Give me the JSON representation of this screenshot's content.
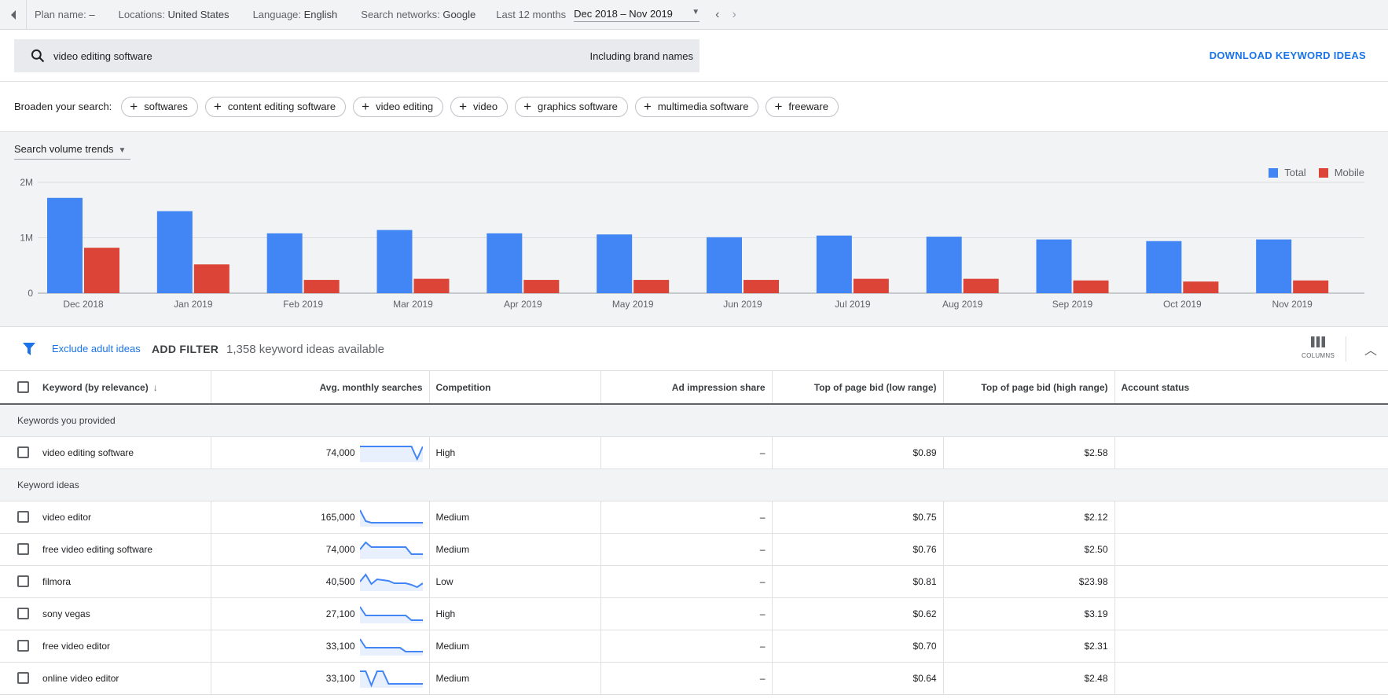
{
  "topbar": {
    "plan_label": "Plan name:",
    "plan_value": "–",
    "locations_label": "Locations:",
    "locations_value": "United States",
    "language_label": "Language:",
    "language_value": "English",
    "networks_label": "Search networks:",
    "networks_value": "Google",
    "period_label": "Last 12 months",
    "period_value": "Dec 2018 – Nov 2019"
  },
  "search": {
    "query": "video editing software",
    "brand_toggle": "Including brand names",
    "download_label": "DOWNLOAD KEYWORD IDEAS"
  },
  "broaden": {
    "label": "Broaden your search:",
    "chips": [
      "softwares",
      "content editing software",
      "video editing",
      "video",
      "graphics software",
      "multimedia software",
      "freeware"
    ]
  },
  "trend": {
    "selector_label": "Search volume trends"
  },
  "chart_data": {
    "type": "bar",
    "categories": [
      "Dec 2018",
      "Jan 2019",
      "Feb 2019",
      "Mar 2019",
      "Apr 2019",
      "May 2019",
      "Jun 2019",
      "Jul 2019",
      "Aug 2019",
      "Sep 2019",
      "Oct 2019",
      "Nov 2019"
    ],
    "series": [
      {
        "name": "Total",
        "color": "#4285f4",
        "values": [
          1720000,
          1480000,
          1080000,
          1140000,
          1080000,
          1060000,
          1010000,
          1040000,
          1020000,
          970000,
          940000,
          970000
        ]
      },
      {
        "name": "Mobile",
        "color": "#db4437",
        "values": [
          820000,
          520000,
          240000,
          260000,
          240000,
          240000,
          240000,
          260000,
          260000,
          230000,
          210000,
          230000
        ]
      }
    ],
    "y_ticks": [
      {
        "value": 0,
        "label": "0"
      },
      {
        "value": 1000000,
        "label": "1M"
      },
      {
        "value": 2000000,
        "label": "2M"
      }
    ],
    "ylim": [
      0,
      2000000
    ],
    "grid": true,
    "legend_position": "top-right"
  },
  "filters": {
    "exclude_label": "Exclude adult ideas",
    "add_filter_label": "ADD FILTER",
    "available_text": "1,358 keyword ideas available",
    "columns_label": "COLUMNS"
  },
  "table": {
    "headers": {
      "keyword": "Keyword (by relevance)",
      "avg": "Avg. monthly searches",
      "competition": "Competition",
      "impression": "Ad impression share",
      "bid_low": "Top of page bid (low range)",
      "bid_high": "Top of page bid (high range)",
      "status": "Account status"
    },
    "group_provided": "Keywords you provided",
    "group_ideas": "Keyword ideas",
    "provided": [
      {
        "keyword": "video editing software",
        "avg": "74,000",
        "competition": "High",
        "impression": "–",
        "bid_low": "$0.89",
        "bid_high": "$2.58",
        "trend": [
          0.1,
          0.1,
          0.1,
          0.1,
          0.1,
          0.1,
          0.1,
          0.1,
          0.1,
          0.1,
          0.9,
          0.1
        ]
      }
    ],
    "ideas": [
      {
        "keyword": "video editor",
        "avg": "165,000",
        "competition": "Medium",
        "impression": "–",
        "bid_low": "$0.75",
        "bid_high": "$2.12",
        "trend": [
          0.05,
          0.75,
          0.85,
          0.85,
          0.85,
          0.85,
          0.85,
          0.85,
          0.85,
          0.85,
          0.85,
          0.85
        ]
      },
      {
        "keyword": "free video editing software",
        "avg": "74,000",
        "competition": "Medium",
        "impression": "–",
        "bid_low": "$0.76",
        "bid_high": "$2.50",
        "trend": [
          0.5,
          0.05,
          0.35,
          0.35,
          0.35,
          0.35,
          0.35,
          0.35,
          0.35,
          0.8,
          0.8,
          0.8
        ]
      },
      {
        "keyword": "filmora",
        "avg": "40,500",
        "competition": "Low",
        "impression": "–",
        "bid_low": "$0.81",
        "bid_high": "$23.98",
        "trend": [
          0.5,
          0.05,
          0.65,
          0.35,
          0.4,
          0.45,
          0.6,
          0.6,
          0.6,
          0.7,
          0.85,
          0.6
        ]
      },
      {
        "keyword": "sony vegas",
        "avg": "27,100",
        "competition": "High",
        "impression": "–",
        "bid_low": "$0.62",
        "bid_high": "$3.19",
        "trend": [
          0.05,
          0.6,
          0.6,
          0.6,
          0.6,
          0.6,
          0.6,
          0.6,
          0.6,
          0.9,
          0.9,
          0.9
        ]
      },
      {
        "keyword": "free video editor",
        "avg": "33,100",
        "competition": "Medium",
        "impression": "–",
        "bid_low": "$0.70",
        "bid_high": "$2.31",
        "trend": [
          0.05,
          0.6,
          0.6,
          0.6,
          0.6,
          0.6,
          0.6,
          0.6,
          0.85,
          0.85,
          0.85,
          0.85
        ]
      },
      {
        "keyword": "online video editor",
        "avg": "33,100",
        "competition": "Medium",
        "impression": "–",
        "bid_low": "$0.64",
        "bid_high": "$2.48",
        "trend": [
          0.05,
          0.05,
          0.95,
          0.05,
          0.05,
          0.85,
          0.85,
          0.85,
          0.85,
          0.85,
          0.85,
          0.85
        ]
      }
    ]
  }
}
